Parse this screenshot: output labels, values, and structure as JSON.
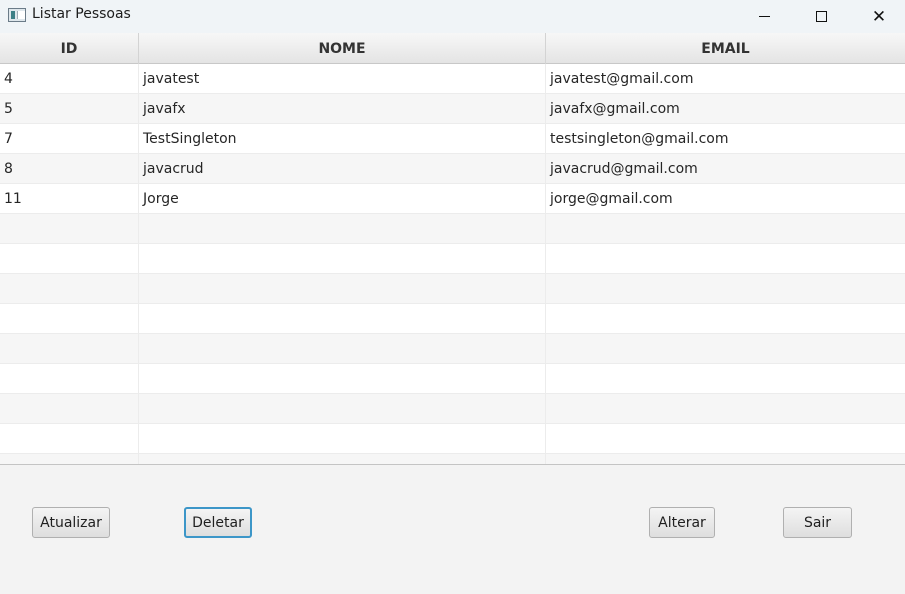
{
  "window": {
    "title": "Listar Pessoas",
    "icon": "app-window-icon",
    "controls": [
      "minimize-icon",
      "maximize-icon",
      "close-icon"
    ],
    "close_glyph": "✕"
  },
  "table": {
    "columns": [
      "ID",
      "NOME",
      "EMAIL"
    ],
    "rows": [
      [
        "4",
        "javatest",
        "javatest@gmail.com"
      ],
      [
        "5",
        "javafx",
        "javafx@gmail.com"
      ],
      [
        "7",
        "TestSingleton",
        "testsingleton@gmail.com"
      ],
      [
        "8",
        "javacrud",
        "javacrud@gmail.com"
      ],
      [
        "11",
        "Jorge",
        "jorge@gmail.com"
      ]
    ]
  },
  "buttons": {
    "atualizar": "Atualizar",
    "deletar": "Deletar",
    "alterar": "Alterar",
    "sair": "Sair"
  },
  "colors": {
    "focus_ring": "#3c96c8",
    "titlebar": "#f0f4f7"
  }
}
